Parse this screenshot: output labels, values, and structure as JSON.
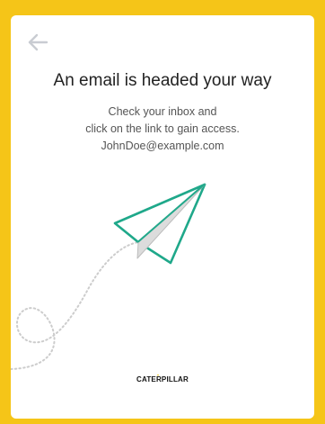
{
  "header": {
    "back_icon": "arrow-left-icon"
  },
  "main": {
    "title": "An email is headed your way",
    "message_line1": "Check your inbox and",
    "message_line2": "click on the link to gain access.",
    "email": "JohnDoe@example.com"
  },
  "illustration": {
    "icon": "paper-plane-icon",
    "plane_color": "#1fa88a",
    "trail_color": "#cccccc"
  },
  "footer": {
    "logo_text": "CATERPILLAR"
  },
  "colors": {
    "page_background": "#f5c518",
    "card_background": "#ffffff"
  }
}
